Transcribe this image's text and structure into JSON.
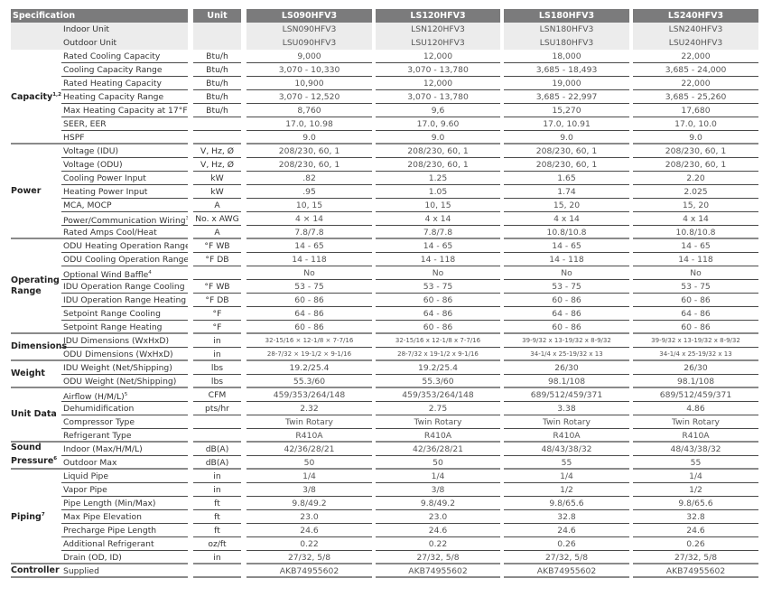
{
  "table": {
    "headers": {
      "spec": "Specification",
      "unit": "Unit",
      "models": [
        "LS090HFV3",
        "LS120HFV3",
        "LS180HFV3",
        "LS240HFV3"
      ]
    },
    "model_rows": [
      {
        "name": "Indoor Unit",
        "values": [
          "LSN090HFV3",
          "LSN120HFV3",
          "LSN180HFV3",
          "LSN240HFV3"
        ]
      },
      {
        "name": "Outdoor Unit",
        "values": [
          "LSU090HFV3",
          "LSU120HFV3",
          "LSU180HFV3",
          "LSU240HFV3"
        ]
      }
    ],
    "groups": [
      {
        "label": "Capacity",
        "sup": "1,2",
        "rows": [
          {
            "name": "Rated Cooling Capacity",
            "unit": "Btu/h",
            "values": [
              "9,000",
              "12,000",
              "18,000",
              "22,000"
            ]
          },
          {
            "name": "Cooling Capacity Range",
            "unit": "Btu/h",
            "values": [
              "3,070 - 10,330",
              "3,070 - 13,780",
              "3,685 - 18,493",
              "3,685 - 24,000"
            ]
          },
          {
            "name": "Rated Heating Capacity",
            "unit": "Btu/h",
            "values": [
              "10,900",
              "12,000",
              "19,000",
              "22,000"
            ]
          },
          {
            "name": "Heating Capacity Range",
            "unit": "Btu/h",
            "values": [
              "3,070 - 12,520",
              "3,070 - 13,780",
              "3,685 - 22,997",
              "3,685 - 25,260"
            ]
          },
          {
            "name": "Max Heating Capacity at 17°F",
            "unit": "Btu/h",
            "values": [
              "8,760",
              "9,6",
              "15,270",
              "17,680"
            ]
          },
          {
            "name": "SEER, EER",
            "unit": "",
            "values": [
              "17.0, 10.98",
              "17.0, 9.60",
              "17.0, 10.91",
              "17.0, 10.0"
            ]
          },
          {
            "name": "HSPF",
            "unit": "",
            "values": [
              "9.0",
              "9.0",
              "9.0",
              "9.0"
            ]
          }
        ]
      },
      {
        "label": "Power",
        "sup": "",
        "rows": [
          {
            "name": "Voltage (IDU)",
            "unit": "V, Hz, Ø",
            "values": [
              "208/230, 60, 1",
              "208/230, 60, 1",
              "208/230, 60, 1",
              "208/230, 60, 1"
            ]
          },
          {
            "name": "Voltage (ODU)",
            "unit": "V, Hz, Ø",
            "values": [
              "208/230, 60, 1",
              "208/230, 60, 1",
              "208/230, 60, 1",
              "208/230, 60, 1"
            ]
          },
          {
            "name": "Cooling Power Input",
            "unit": "kW",
            "values": [
              ".82",
              "1.25",
              "1.65",
              "2.20"
            ]
          },
          {
            "name": "Heating Power Input",
            "unit": "kW",
            "values": [
              ".95",
              "1.05",
              "1.74",
              "2.025"
            ]
          },
          {
            "name": "MCA, MOCP",
            "unit": "A",
            "values": [
              "10, 15",
              "10, 15",
              "15, 20",
              "15, 20"
            ]
          },
          {
            "name": "Power/Communication Wiring",
            "sup": "3",
            "unit": "No. x AWG",
            "values": [
              "4 × 14",
              "4 x 14",
              "4 x 14",
              "4 x 14"
            ]
          },
          {
            "name": "Rated Amps Cool/Heat",
            "unit": "A",
            "values": [
              "7.8/7.8",
              "7.8/7.8",
              "10.8/10.8",
              "10.8/10.8"
            ]
          }
        ]
      },
      {
        "label": "Operating Range",
        "sup": "",
        "rows": [
          {
            "name": "ODU Heating Operation Range",
            "unit": "°F WB",
            "values": [
              "14 - 65",
              "14 - 65",
              "14 - 65",
              "14 - 65"
            ]
          },
          {
            "name": "ODU Cooling Operation Range",
            "unit": "°F DB",
            "values": [
              "14 - 118",
              "14 - 118",
              "14 - 118",
              "14 - 118"
            ]
          },
          {
            "name": "Optional Wind Baffle",
            "sup": "4",
            "unit": "",
            "values": [
              "No",
              "No",
              "No",
              "No"
            ]
          },
          {
            "name": "IDU Operation Range Cooling",
            "unit": "°F WB",
            "values": [
              "53 - 75",
              "53 - 75",
              "53 - 75",
              "53 - 75"
            ]
          },
          {
            "name": "IDU Operation Range Heating",
            "unit": "°F DB",
            "values": [
              "60 - 86",
              "60 - 86",
              "60 - 86",
              "60 - 86"
            ]
          },
          {
            "name": "Setpoint Range Cooling",
            "unit": "°F",
            "values": [
              "64 - 86",
              "64 - 86",
              "64 - 86",
              "64 - 86"
            ]
          },
          {
            "name": "Setpoint Range Heating",
            "unit": "°F",
            "values": [
              "60 - 86",
              "60 - 86",
              "60 - 86",
              "60 - 86"
            ]
          }
        ]
      },
      {
        "label": "Dimensions",
        "sup": "",
        "rows": [
          {
            "name": "IDU Dimensions (WxHxD)",
            "unit": "in",
            "small": true,
            "values": [
              "32-15/16 × 12-1/8 × 7-7/16",
              "32-15/16 x 12-1/8 x 7-7/16",
              "39-9/32 x 13-19/32 x 8-9/32",
              "39-9/32 x 13-19/32 x 8-9/32"
            ]
          },
          {
            "name": "ODU Dimensions (WxHxD)",
            "unit": "in",
            "small": true,
            "values": [
              "28-7/32 × 19-1/2 × 9-1/16",
              "28-7/32 x 19-1/2 x 9-1/16",
              "34-1/4 x 25-19/32 x 13",
              "34-1/4 x 25-19/32 x 13"
            ]
          }
        ]
      },
      {
        "label": "Weight",
        "sup": "",
        "rows": [
          {
            "name": "IDU Weight (Net/Shipping)",
            "unit": "lbs",
            "values": [
              "19.2/25.4",
              "19.2/25.4",
              "26/30",
              "26/30"
            ]
          },
          {
            "name": "ODU Weight (Net/Shipping)",
            "unit": "lbs",
            "values": [
              "55.3/60",
              "55.3/60",
              "98.1/108",
              "98.1/108"
            ]
          }
        ]
      },
      {
        "label": "Unit Data",
        "sup": "",
        "rows": [
          {
            "name": "Airflow (H/M/L)",
            "sup": "5",
            "unit": "CFM",
            "values": [
              "459/353/264/148",
              "459/353/264/148",
              "689/512/459/371",
              "689/512/459/371"
            ]
          },
          {
            "name": "Dehumidification",
            "unit": "pts/hr",
            "values": [
              "2.32",
              "2.75",
              "3.38",
              "4.86"
            ]
          },
          {
            "name": "Compressor Type",
            "unit": "",
            "values": [
              "Twin Rotary",
              "Twin Rotary",
              "Twin Rotary",
              "Twin Rotary"
            ]
          },
          {
            "name": "Refrigerant Type",
            "unit": "",
            "values": [
              "R410A",
              "R410A",
              "R410A",
              "R410A"
            ]
          }
        ]
      },
      {
        "label": "Sound Pressure",
        "sup": "6",
        "rows": [
          {
            "name": "Indoor (Max/H/M/L)",
            "unit": "dB(A)",
            "values": [
              "42/36/28/21",
              "42/36/28/21",
              "48/43/38/32",
              "48/43/38/32"
            ]
          },
          {
            "name": "Outdoor Max",
            "unit": "dB(A)",
            "values": [
              "50",
              "50",
              "55",
              "55"
            ]
          }
        ]
      },
      {
        "label": "Piping",
        "sup": "7",
        "rows": [
          {
            "name": "Liquid Pipe",
            "unit": "in",
            "values": [
              "1/4",
              "1/4",
              "1/4",
              "1/4"
            ]
          },
          {
            "name": "Vapor Pipe",
            "unit": "in",
            "values": [
              "3/8",
              "3/8",
              "1/2",
              "1/2"
            ]
          },
          {
            "name": "Pipe Length (Min/Max)",
            "unit": "ft",
            "values": [
              "9.8/49.2",
              "9.8/49.2",
              "9.8/65.6",
              "9.8/65.6"
            ]
          },
          {
            "name": "Max Pipe Elevation",
            "unit": "ft",
            "values": [
              "23.0",
              "23.0",
              "32.8",
              "32.8"
            ]
          },
          {
            "name": "Precharge Pipe Length",
            "unit": "ft",
            "values": [
              "24.6",
              "24.6",
              "24.6",
              "24.6"
            ]
          },
          {
            "name": "Additional Refrigerant",
            "unit": "oz/ft",
            "values": [
              "0.22",
              "0.22",
              "0.26",
              "0.26"
            ]
          },
          {
            "name": "Drain (OD, ID)",
            "unit": "in",
            "values": [
              "27/32, 5/8",
              "27/32, 5/8",
              "27/32, 5/8",
              "27/32, 5/8"
            ]
          }
        ]
      },
      {
        "label": "Controller",
        "sup": "",
        "rows": [
          {
            "name": "Supplied",
            "unit": "",
            "values": [
              "AKB74955602",
              "AKB74955602",
              "AKB74955602",
              "AKB74955602"
            ]
          }
        ]
      }
    ]
  }
}
